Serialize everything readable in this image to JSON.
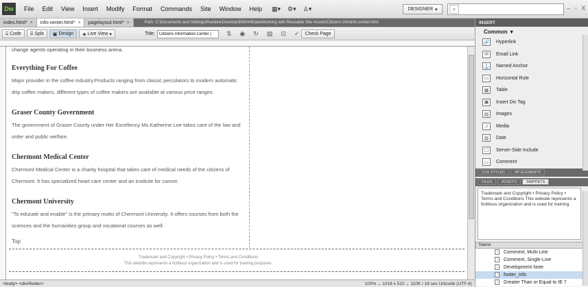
{
  "app": {
    "logo": "Dw",
    "menu": [
      "File",
      "Edit",
      "View",
      "Insert",
      "Modify",
      "Format",
      "Commands",
      "Site",
      "Window",
      "Help"
    ],
    "workspace": "DESIGNER",
    "search_placeholder": "",
    "window_controls": "– ▫ X"
  },
  "tabs": [
    {
      "label": "index.html*",
      "active": false
    },
    {
      "label": "info-center.html*",
      "active": true
    },
    {
      "label": "pagelayout.html*",
      "active": false
    }
  ],
  "path": "Path: C:\\Documents and Settings\\Randee\\Desktop\\994044Data\\Working with Reusable Site Assets\\Citizens Info\\info-center.html",
  "toolbar": {
    "code": "Code",
    "split": "Split",
    "design": "Design",
    "live_view": "Live View",
    "title_label": "Title:",
    "title_value": "Citizens Information Center |",
    "check_page": "Check Page"
  },
  "document": {
    "intro": "change agents operating in their business arena.",
    "sections": [
      {
        "heading": "Everything For Coffee",
        "body": "Major provider in the coffee industry.Products ranging from classic percolators to modern automatic drip coffee makers, different types of coffee makers are available at various price ranges."
      },
      {
        "heading": "Graser County Government",
        "body": "The government of Graser County under Her Excellency Ms.Katherine Lee takes care of the law and order and public welfare."
      },
      {
        "heading": "Chermont Medical Center",
        "body": "Chermont Medical Center is a charity hospital that takes care of medical needs of the citizens of Chermont. It has specialized heart care center and an institute for cancer."
      },
      {
        "heading": "Chermont University",
        "body": "\"To educate and enable\" is the primary motto of Chermont University. It offers courses from both the sciences and the humanities group and vocational courses as well."
      }
    ],
    "top_link": "Top",
    "footer_line1": "Trademark and Copyright • Privacy Policy • Terms and Conditions",
    "footer_line2": "This website represents a fictitious organization and is used for training purposes."
  },
  "status": {
    "tag_selector": "<body> <div#footer>",
    "info": "100%  ⌄  1018 x 510 ⌄  110K / 16 sec  Unicode (UTF-8)"
  },
  "insert_panel": {
    "header": "INSERT",
    "category": "Common",
    "items": [
      {
        "label": "Hyperlink",
        "icon": "🔗"
      },
      {
        "label": "Email Link",
        "icon": "✉"
      },
      {
        "label": "Named Anchor",
        "icon": "⚓"
      },
      {
        "label": "Horizontal Rule",
        "icon": "▭"
      },
      {
        "label": "Table",
        "icon": "▦"
      },
      {
        "label": "Insert Div Tag",
        "icon": "▣"
      },
      {
        "label": "Images",
        "icon": "▤"
      },
      {
        "label": "Media",
        "icon": "♫"
      },
      {
        "label": "Date",
        "icon": "▥"
      },
      {
        "label": "Server-Side Include",
        "icon": "▢"
      },
      {
        "label": "Comment",
        "icon": "▭"
      }
    ]
  },
  "css_tabs": [
    "CSS STYLES",
    "AP ELEMENTS"
  ],
  "files_tabs": [
    "FILES",
    "ASSETS",
    "SNIPPETS"
  ],
  "snippet_preview": "Trademark and Copyright • Privacy Policy • Terms and Conditions This website represents a fictitious organization and is used for training",
  "snippet_name_header": "Name",
  "snippets": [
    {
      "label": "Comment, Multi-Line",
      "selected": false
    },
    {
      "label": "Comment, Single-Line",
      "selected": false
    },
    {
      "label": "Development Note",
      "selected": false
    },
    {
      "label": "footer_info",
      "selected": true
    },
    {
      "label": "Greater Than or Equal to IE 7",
      "selected": false
    }
  ]
}
